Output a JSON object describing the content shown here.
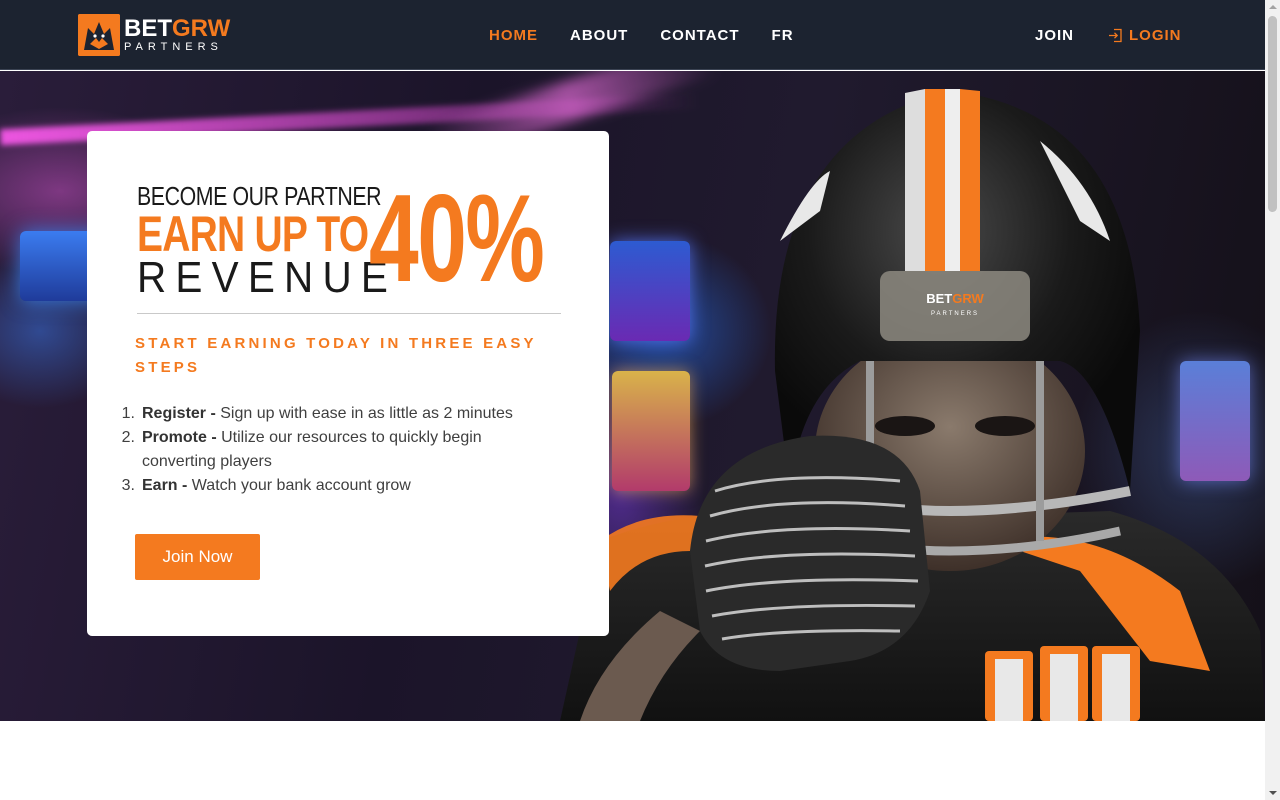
{
  "header": {
    "logo": {
      "brand_main": "BET",
      "brand_accent": "GRW",
      "brand_sub": "PARTNERS",
      "icon": "wolf-logo-icon"
    },
    "nav": [
      {
        "label": "HOME",
        "active": true
      },
      {
        "label": "ABOUT",
        "active": false
      },
      {
        "label": "CONTACT",
        "active": false
      },
      {
        "label": "FR",
        "active": false
      }
    ],
    "join_label": "JOIN",
    "login_label": "LOGIN",
    "login_icon": "login-icon"
  },
  "hero": {
    "headline": {
      "line1": "BECOME OUR PARTNER",
      "line2": "EARN UP TO",
      "line3": "REVENUE",
      "big": "40%"
    },
    "subheading": "START EARNING TODAY IN THREE EASY STEPS",
    "steps": [
      {
        "num": "1.",
        "title": "Register -",
        "text": " Sign up with ease in as little as 2 minutes"
      },
      {
        "num": "2.",
        "title": "Promote -",
        "text": " Utilize our resources to quickly begin converting players"
      },
      {
        "num": "3.",
        "title": "Earn -",
        "text": " Watch your bank account grow"
      }
    ],
    "cta_label": "Join Now",
    "helmet_logo_main": "BET",
    "helmet_logo_accent": "GRW",
    "helmet_logo_sub": "PARTNERS"
  },
  "colors": {
    "accent": "#f47a1f",
    "header_bg": "#1c2330",
    "text_dark": "#1a1a1a",
    "text_body": "#3f3f3f"
  }
}
